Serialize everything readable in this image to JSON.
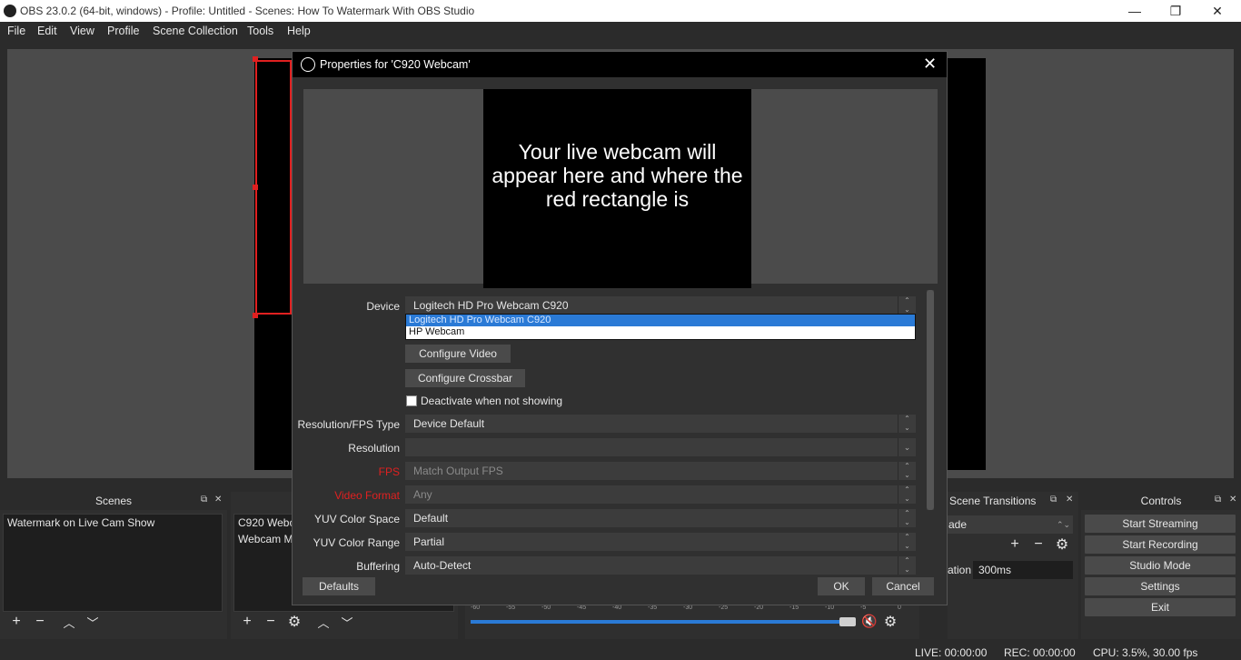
{
  "window": {
    "title": "OBS 23.0.2 (64-bit, windows) - Profile: Untitled - Scenes: How To Watermark With OBS Studio",
    "minimize": "—",
    "restore": "❐",
    "close": "✕"
  },
  "menu": [
    "File",
    "Edit",
    "View",
    "Profile",
    "Scene Collection",
    "Tools",
    "Help"
  ],
  "scenes": {
    "title": "Scenes",
    "items": [
      "Watermark on Live Cam Show"
    ]
  },
  "sources": {
    "items": [
      "C920 Webca",
      "Webcam Mic"
    ]
  },
  "mixer": {
    "ticks": [
      "-60",
      "-55",
      "-50",
      "-45",
      "-40",
      "-35",
      "-30",
      "-25",
      "-20",
      "-15",
      "-10",
      "-5",
      "0"
    ]
  },
  "transitions": {
    "title": "Scene Transitions",
    "transition_value": "ade",
    "duration_label": "ation",
    "duration_value": "300ms"
  },
  "controls": {
    "title": "Controls",
    "buttons": [
      "Start Streaming",
      "Start Recording",
      "Studio Mode",
      "Settings",
      "Exit"
    ]
  },
  "dialog": {
    "title": "Properties for 'C920 Webcam'",
    "preview_text": "Your live webcam will appear here and where the red rectangle is",
    "device_label": "Device",
    "device_value": "Logitech HD Pro Webcam C920",
    "device_options": [
      "Logitech HD Pro Webcam C920",
      "HP Webcam"
    ],
    "configure_video": "Configure Video",
    "configure_crossbar": "Configure Crossbar",
    "deactivate_label": "Deactivate when not showing",
    "fields": [
      {
        "label": "Resolution/FPS Type",
        "value": "Device Default"
      },
      {
        "label": "Resolution",
        "value": ""
      },
      {
        "label": "FPS",
        "value": "Match Output FPS"
      },
      {
        "label": "Video Format",
        "value": "Any"
      },
      {
        "label": "YUV Color Space",
        "value": "Default"
      },
      {
        "label": "YUV Color Range",
        "value": "Partial"
      },
      {
        "label": "Buffering",
        "value": "Auto-Detect"
      }
    ],
    "defaults_button": "Defaults",
    "ok_button": "OK",
    "cancel_button": "Cancel"
  },
  "status": {
    "live": "LIVE: 00:00:00",
    "rec": "REC: 00:00:00",
    "cpu": "CPU: 3.5%, 30.00 fps"
  },
  "colors": {
    "selection_red": "#e02020",
    "dropdown_highlight": "#2a7ad6",
    "volume_bar": "#2a7ad6"
  }
}
